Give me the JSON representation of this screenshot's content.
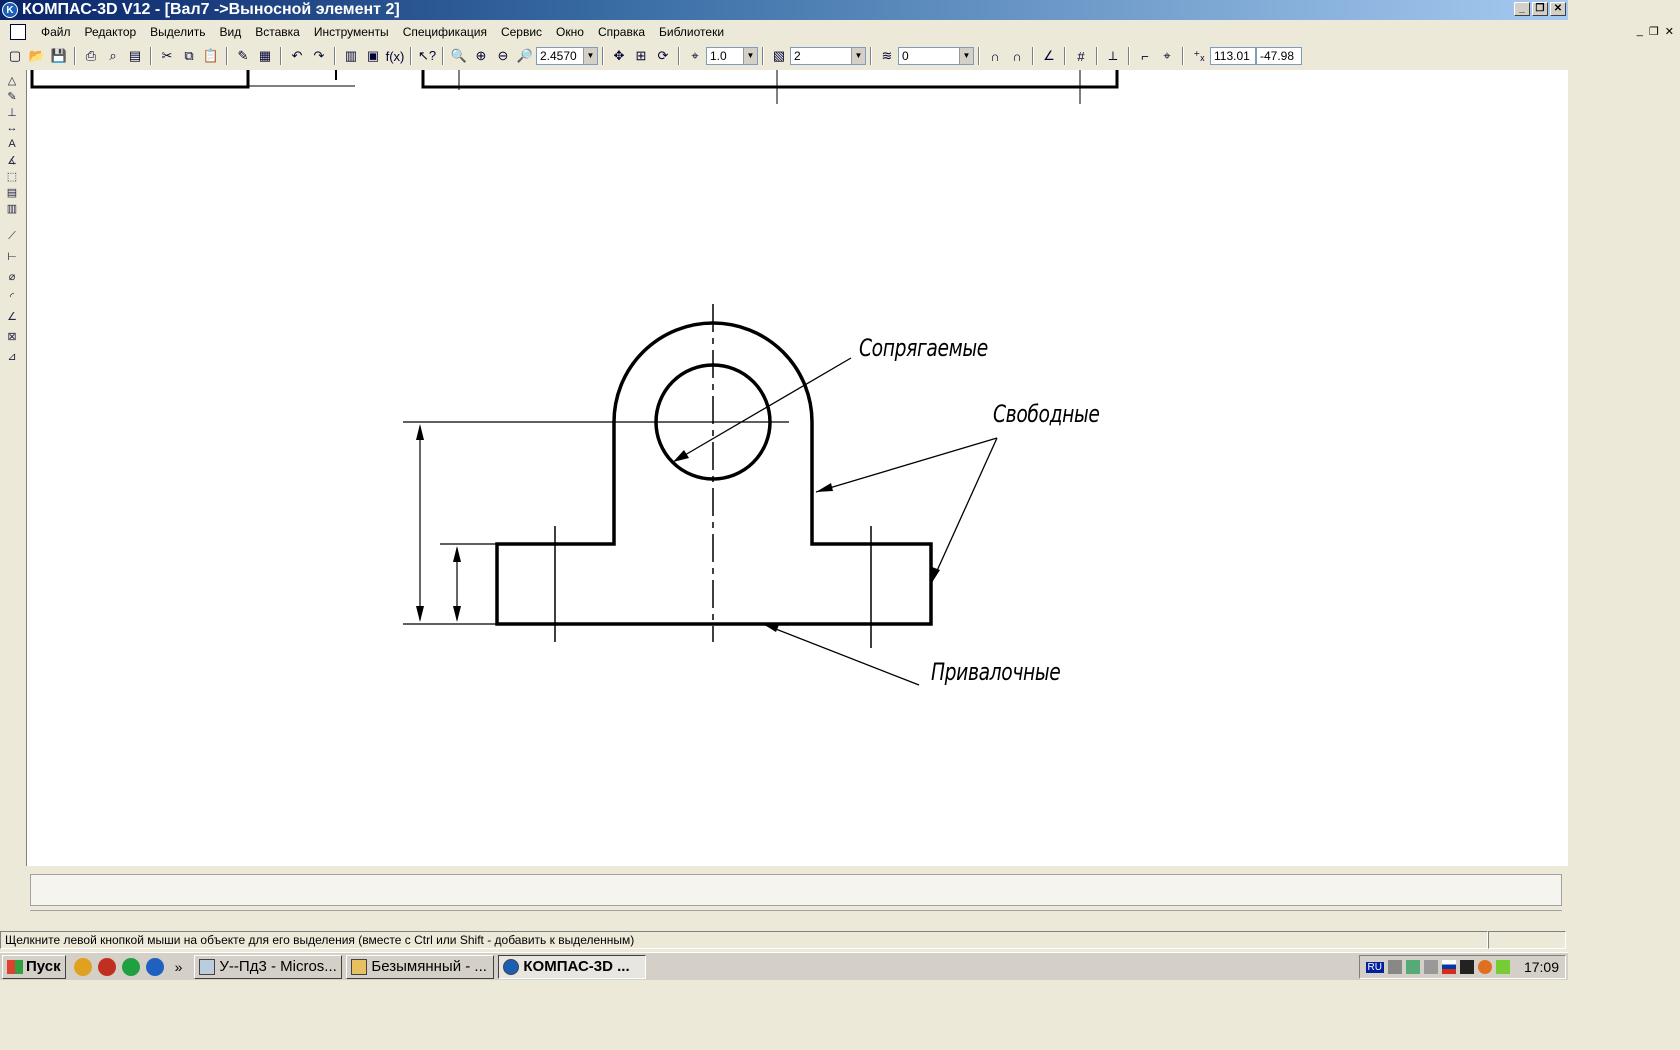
{
  "window": {
    "title": "КОМПАС-3D V12 - [Вал7 ->Выносной элемент 2]",
    "app_icon": "kompas-icon",
    "controls": [
      "_",
      "❐",
      "✕"
    ]
  },
  "menu": {
    "items": [
      "Файл",
      "Редактор",
      "Выделить",
      "Вид",
      "Вставка",
      "Инструменты",
      "Спецификация",
      "Сервис",
      "Окно",
      "Справка",
      "Библиотеки"
    ]
  },
  "toolbar": {
    "zoom_value": "2.4570",
    "step_value": "1.0",
    "style_value": "2",
    "layer_value": "0",
    "coord_x": "113.01",
    "coord_y": "-47.98"
  },
  "drawing": {
    "labels": {
      "mating": "Сопрягаемые",
      "free": "Свободные",
      "contact": "Привалочные"
    }
  },
  "status": {
    "hint": "Щелкните левой кнопкой мыши на объекте для его выделения (вместе с Ctrl или Shift - добавить к выделенным)"
  },
  "taskbar": {
    "start_label": "Пуск",
    "tasks": [
      {
        "label": "У--Пд3 - Micros...",
        "active": false
      },
      {
        "label": "Безымянный - ...",
        "active": false
      },
      {
        "label": "КОМПАС-3D ...",
        "active": true
      }
    ],
    "language": "RU",
    "clock": "17:09"
  }
}
